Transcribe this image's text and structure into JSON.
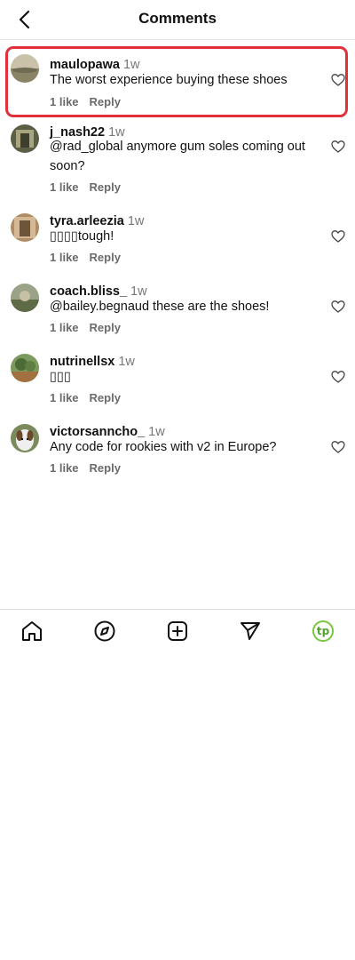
{
  "header": {
    "title": "Comments"
  },
  "comments": [
    {
      "username": "maulopawa",
      "time": "1w",
      "text": "The worst experience buying these shoes",
      "likes": "1 like",
      "reply": "Reply"
    },
    {
      "username": "j_nash22",
      "time": "1w",
      "text": "@rad_global anymore gum soles coming out soon?",
      "likes": "1 like",
      "reply": "Reply"
    },
    {
      "username": "tyra.arleezia",
      "time": "1w",
      "text": "▯▯▯▯tough!",
      "likes": "1 like",
      "reply": "Reply"
    },
    {
      "username": "coach.bliss_",
      "time": "1w",
      "text": "@bailey.begnaud these are the shoes!",
      "likes": "1 like",
      "reply": "Reply"
    },
    {
      "username": "nutrinellsx",
      "time": "1w",
      "text": "▯▯▯",
      "likes": "1 like",
      "reply": "Reply"
    },
    {
      "username": "victorsanncho_",
      "time": "1w",
      "text": "Any code for rookies with v2 in Europe?",
      "likes": "1 like",
      "reply": "Reply"
    }
  ],
  "bottom_nav": {
    "items": [
      "home-icon",
      "explore-icon",
      "create-icon",
      "send-icon",
      "profile-icon"
    ],
    "profile_label": "tp"
  },
  "colors": {
    "highlight": "#e0313b",
    "profile_accent": "#7cc63b"
  }
}
